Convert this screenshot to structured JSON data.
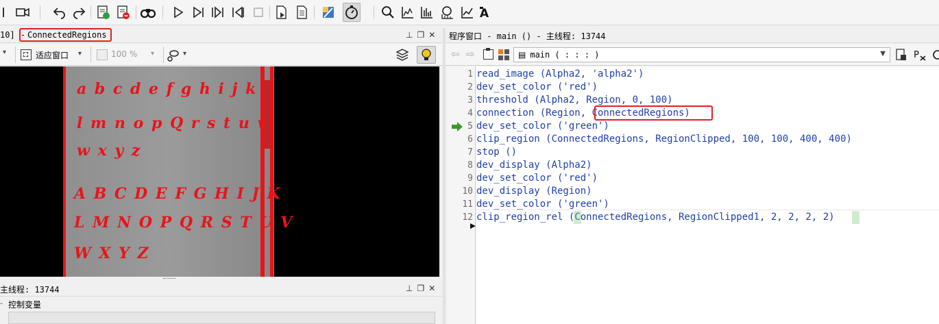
{
  "toolbar": {
    "icons": [
      "stop-icon",
      "camera-icon",
      "undo-icon",
      "redo-icon",
      "breakpoint-set-icon",
      "breakpoint-clear-icon",
      "find-icon",
      "run-icon",
      "step-over-icon",
      "step-into-icon",
      "step-out-icon",
      "reset-icon",
      "open-doc-icon",
      "properties-icon",
      "edit-icon",
      "timer-icon",
      "zoom-icon",
      "histogram-icon",
      "line-profile-icon",
      "gray-histogram-icon",
      "feature-inspect-icon",
      "ocr-icon"
    ]
  },
  "graphics_window": {
    "title_prefix": "10]",
    "title_separator": "-",
    "title_name": "ConnectedRegions",
    "fit_label": "适应窗口",
    "zoom_value": "100 %",
    "image_letters": [
      "a b c d e f g h i j k",
      "l m n o p Q r s t u v",
      "w x y z",
      "A B C D E F G H I J K",
      "L M N O P Q R S T U V",
      "W X Y Z"
    ]
  },
  "variable_window": {
    "title": "主线程: 13744",
    "tab_label": "控制变量"
  },
  "program_window": {
    "title": "程序窗口 - main () - 主线程: 13744",
    "procedure_value": "main ( : : : )",
    "current_line": 5,
    "lines": [
      {
        "num": "1",
        "code": "read_image (Alpha2, 'alpha2')"
      },
      {
        "num": "2",
        "code": "dev_set_color ('red')"
      },
      {
        "num": "3",
        "code": "threshold (Alpha2, Region, 0, 100)"
      },
      {
        "num": "4",
        "code": "connection (Region, ConnectedRegions)"
      },
      {
        "num": "5",
        "code": "dev_set_color ('green')"
      },
      {
        "num": "6",
        "code": "clip_region (ConnectedRegions, RegionClipped, 100, 100, 400, 400)"
      },
      {
        "num": "7",
        "code": "stop ()"
      },
      {
        "num": "8",
        "code": "dev_display (Alpha2)"
      },
      {
        "num": "9",
        "code": "dev_set_color ('red')"
      },
      {
        "num": "10",
        "code": "dev_display (Region)"
      },
      {
        "num": "11",
        "code": "dev_set_color ('green')"
      },
      {
        "num": "12",
        "code": "clip_region_rel (ConnectedRegions, RegionClipped1, 2, 2, 2, 2)"
      }
    ]
  },
  "colors": {
    "code_text": "#1f3fa8",
    "highlight_box": "#e02020",
    "region_red": "#e8141a"
  }
}
